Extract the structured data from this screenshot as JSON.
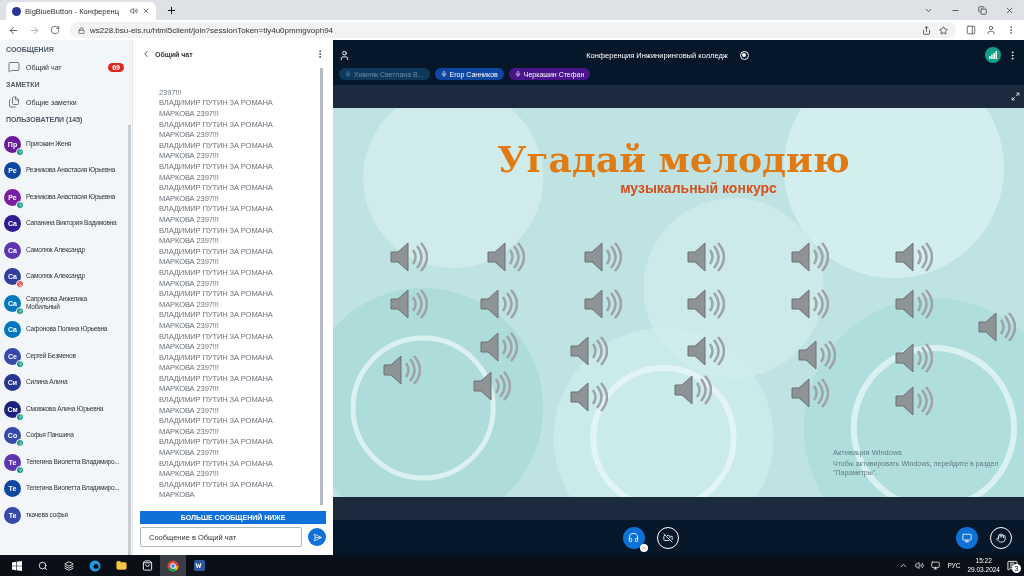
{
  "browser": {
    "tab_title": "BigBlueButton - Конференц",
    "url": "ws228.bsu-eis.ru/html5client/join?sessionToken=tiy4u0pmmgvoph94"
  },
  "sidebar": {
    "messages_heading": "СООБЩЕНИЯ",
    "public_chat": {
      "label": "Общий чат",
      "badge": "69"
    },
    "notes_heading": "ЗАМЕТКИ",
    "notes": {
      "label": "Общие заметки"
    },
    "users_heading": "ПОЛЬЗОВАТЕЛИ (145)",
    "users": [
      {
        "initials": "Пр",
        "name": "Пригожин Женя",
        "color": "#6a1b9a",
        "kind": "mic"
      },
      {
        "initials": "Ре",
        "name": "Резникова Анастасия Юрьевна",
        "color": "#0d47a1",
        "kind": "none"
      },
      {
        "initials": "Ре",
        "name": "Резникова Анастасия Юрьевна",
        "color": "#7b1fa2",
        "kind": "mic"
      },
      {
        "initials": "Са",
        "name": "Сапанина Виктория Вадимовна",
        "color": "#311b92",
        "kind": "none"
      },
      {
        "initials": "Са",
        "name": "Самолюк Александр",
        "color": "#5e35b1",
        "kind": "none"
      },
      {
        "initials": "Са",
        "name": "Самолюк Александр",
        "color": "#303f9f",
        "kind": "muted"
      },
      {
        "initials": "Са",
        "name": "Сапрунова Анжелика",
        "sub": "Мобильный",
        "color": "#0277bd",
        "kind": "mic"
      },
      {
        "initials": "Са",
        "name": "Сафонова Полина Юрьевна",
        "color": "#0277bd",
        "kind": "none"
      },
      {
        "initials": "Се",
        "name": "Сергей Безменов",
        "color": "#3949ab",
        "kind": "mic"
      },
      {
        "initials": "Си",
        "name": "Силина Алина",
        "color": "#283593",
        "kind": "none"
      },
      {
        "initials": "См",
        "name": "Смовжова Алина Юрьевна",
        "color": "#1a237e",
        "kind": "mic"
      },
      {
        "initials": "Со",
        "name": "Софья Паншина",
        "color": "#3949ab",
        "kind": "mic"
      },
      {
        "initials": "Те",
        "name": "Телегина Виолетта Владимиро...",
        "color": "#5e35b1",
        "kind": "mic"
      },
      {
        "initials": "Те",
        "name": "Телегина Виолетта Владимиро...",
        "color": "#0d47a1",
        "kind": "none"
      },
      {
        "initials": "Тк",
        "name": "ткачева софья",
        "color": "#3949ab",
        "kind": "none"
      }
    ]
  },
  "chat": {
    "title": "Общий чат",
    "messages": [
      "2397!!!",
      "ВЛАДИМИР ПУТИН ЗА РОМАНА МАРКОВА 2397!!!",
      "ВЛАДИМИР ПУТИН ЗА РОМАНА МАРКОВА 2397!!!",
      "ВЛАДИМИР ПУТИН ЗА РОМАНА МАРКОВА 2397!!!",
      "ВЛАДИМИР ПУТИН ЗА РОМАНА МАРКОВА 2397!!!",
      "ВЛАДИМИР ПУТИН ЗА РОМАНА МАРКОВА 2397!!!",
      "ВЛАДИМИР ПУТИН ЗА РОМАНА МАРКОВА 2397!!!",
      "ВЛАДИМИР ПУТИН ЗА РОМАНА МАРКОВА 2397!!!",
      "ВЛАДИМИР ПУТИН ЗА РОМАНА МАРКОВА 2397!!!",
      "ВЛАДИМИР ПУТИН ЗА РОМАНА МАРКОВА 2397!!!",
      "ВЛАДИМИР ПУТИН ЗА РОМАНА МАРКОВА 2397!!!",
      "ВЛАДИМИР ПУТИН ЗА РОМАНА МАРКОВА 2397!!!",
      "ВЛАДИМИР ПУТИН ЗА РОМАНА МАРКОВА 2397!!!",
      "ВЛАДИМИР ПУТИН ЗА РОМАНА МАРКОВА 2397!!!",
      "ВЛАДИМИР ПУТИН ЗА РОМАНА МАРКОВА 2397!!!",
      "ВЛАДИМИР ПУТИН ЗА РОМАНА МАРКОВА 2397!!!",
      "ВЛАДИМИР ПУТИН ЗА РОМАНА МАРКОВА 2397!!!",
      "ВЛАДИМИР ПУТИН ЗА РОМАНА МАРКОВА 2397!!!",
      "ВЛАДИМИР ПУТИН ЗА РОМАНА МАРКОВА 2397!!!",
      "ВЛАДИМИР ПУТИН ЗА РОМАНА МАРКОВА"
    ],
    "more_button": "БОЛЬШЕ СООБЩЕНИЙ НИЖЕ",
    "input_placeholder": "Сообщение в Общий чат"
  },
  "meeting": {
    "title": "Конференция Инжиниринговый колледж",
    "talkers": [
      {
        "name": "Хижняк Светлана В...",
        "color": "#0d3a5c",
        "kind": "faded"
      },
      {
        "name": "Егор Санников",
        "color": "#0d47a1",
        "kind": "talking"
      },
      {
        "name": "Черкашин Стефан",
        "color": "#4a148c",
        "kind": "talking"
      }
    ]
  },
  "slide": {
    "title": "Угадай мелодию",
    "subtitle": "музыкальный конкурс"
  },
  "os_notice": {
    "title": "Активация Windows",
    "text": "Чтобы активировать Windows, перейдите в раздел \"Параметры\"."
  },
  "taskbar": {
    "language": "РУС",
    "time": "15:22",
    "date": "29.03.2024",
    "notifications": "3"
  }
}
